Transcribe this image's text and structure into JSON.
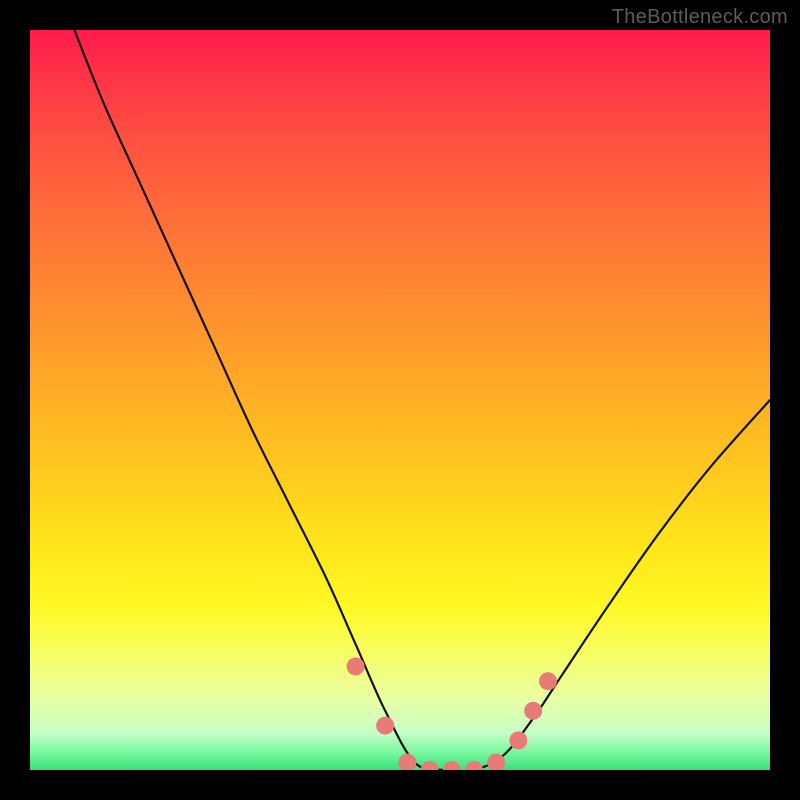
{
  "watermark": "TheBottleneck.com",
  "colors": {
    "frame": "#000000",
    "curve_stroke": "#111111",
    "marker_fill": "#e87a77",
    "gradient_stops": [
      "#ff1a4d",
      "#ff3348",
      "#ff4e42",
      "#ff6a3a",
      "#ff8a30",
      "#ffaa26",
      "#ffca1e",
      "#ffe61a",
      "#fff825",
      "#f7ff60",
      "#eaffa0",
      "#c7ffc7",
      "#6cf598",
      "#39e07f"
    ]
  },
  "chart_data": {
    "type": "line",
    "title": "",
    "xlabel": "",
    "ylabel": "",
    "xlim": [
      0,
      100
    ],
    "ylim": [
      0,
      100
    ],
    "note": "Bottleneck-style V-curve. x and y are percentages of the plot area; y=0 is the bottom edge. Curve minimum (optimum) ≈ x 52–62, y ≈ 0. Left branch rises steeply to y≈100 near x≈6; right branch rises more gently to y≈50 at x=100.",
    "series": [
      {
        "name": "bottleneck-curve",
        "x": [
          6,
          10,
          15,
          20,
          25,
          30,
          35,
          40,
          44,
          48,
          52,
          56,
          60,
          64,
          68,
          72,
          78,
          85,
          92,
          100
        ],
        "y": [
          100,
          90,
          79,
          68,
          57,
          46,
          36,
          26,
          17,
          8,
          1,
          0,
          0,
          2,
          7,
          13,
          22,
          32,
          41,
          50
        ]
      }
    ],
    "markers": {
      "name": "highlight-dots",
      "note": "Salmon dots clustered near the curve minimum and on the lower parts of both branches.",
      "x": [
        44,
        48,
        51,
        54,
        57,
        60,
        63,
        66,
        68,
        70
      ],
      "y": [
        14,
        6,
        1,
        0,
        0,
        0,
        1,
        4,
        8,
        12
      ]
    }
  }
}
